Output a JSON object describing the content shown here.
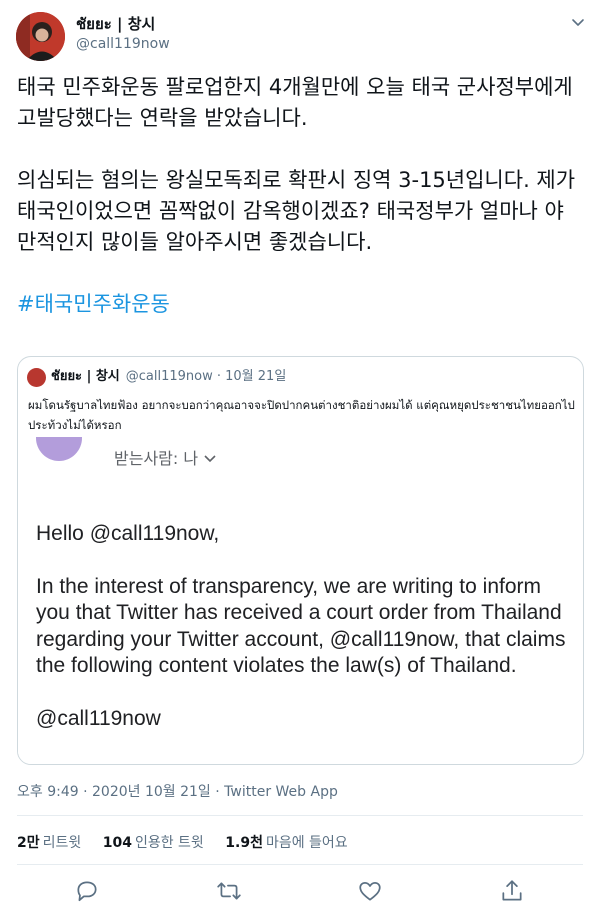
{
  "author": {
    "display_name": "ชัยยะ | 창시",
    "handle": "@call119now"
  },
  "tweet": {
    "paragraph_1": "태국 민주화운동 팔로업한지 4개월만에 오늘 태국 군사정부에게 고발당했다는 연락을 받았습니다.",
    "paragraph_2": "의심되는 혐의는 왕실모독죄로 확판시 징역 3-15년입니다. 제가 태국인이었으면 꼼짝없이 감옥행이겠죠? 태국정부가 얼마나 야만적인지 많이들 알아주시면 좋겠습니다.",
    "hashtag": "#태국민주화운동"
  },
  "quoted_tweet": {
    "display_name": "ชัยยะ | 창시",
    "meta": "@call119now · 10월 21일",
    "text": "ผมโดนรัฐบาลไทยฟ้อง อยากจะบอกว่าคุณอาจจะปิดปากคนต่างชาติอย่างผมได้ แต่คุณหยุดประชาชนไทยออกไปประท้วงไม่ได้หรอก",
    "image": {
      "recipient_label": "받는사람: 나",
      "greeting": "Hello @call119now,",
      "body": "In the interest of transparency, we are writing to inform you that Twitter has received a court order from Thailand regarding your Twitter account, @call119now, that claims the following content violates the law(s) of Thailand.",
      "closing": "@call119now"
    }
  },
  "timestamp": "오후 9:49 · 2020년 10월 21일 · Twitter Web App",
  "stats": {
    "retweets_count": "2만",
    "retweets_label": "리트윗",
    "quotes_count": "104",
    "quotes_label": "인용한 트윗",
    "likes_count": "1.9천",
    "likes_label": "마음에 들어요"
  },
  "icons": [
    "more-icon",
    "reply-icon",
    "retweet-icon",
    "like-icon",
    "share-icon",
    "chevron-down-icon"
  ],
  "colors": {
    "link": "#1b95e0",
    "secondary_text": "#5b7083",
    "email_avatar": "#b39ddb"
  }
}
